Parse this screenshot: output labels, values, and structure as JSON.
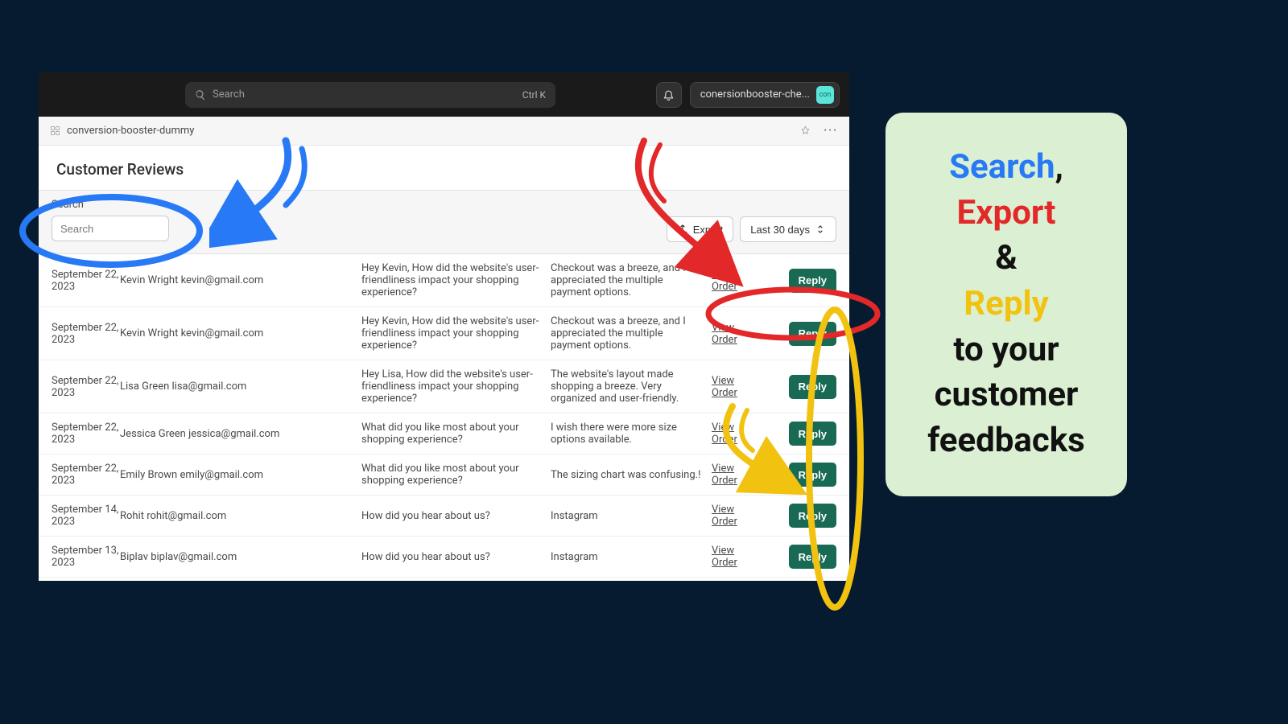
{
  "topbar": {
    "search_placeholder": "Search",
    "kbd": "Ctrl K",
    "store_name": "conersionbooster-che...",
    "avatar_text": "con"
  },
  "breadcrumb": {
    "label": "conversion-booster-dummy"
  },
  "page_title": "Customer Reviews",
  "filters": {
    "search_label": "Search",
    "search_placeholder": "Search",
    "export_label": "Export",
    "daterange_label": "Last 30 days"
  },
  "columns": {
    "view_order_text": "View Order",
    "reply_label": "Reply"
  },
  "reviews": [
    {
      "date": "September 22, 2023",
      "customer": "Kevin Wright kevin@gmail.com",
      "question": "Hey Kevin, How did the website's user-friendliness impact your shopping experience?",
      "answer": "Checkout was a breeze, and I appreciated the multiple payment options."
    },
    {
      "date": "September 22, 2023",
      "customer": "Kevin Wright kevin@gmail.com",
      "question": "Hey Kevin, How did the website's user-friendliness impact your shopping experience?",
      "answer": "Checkout was a breeze, and I appreciated the multiple payment options."
    },
    {
      "date": "September 22, 2023",
      "customer": "Lisa Green lisa@gmail.com",
      "question": "Hey Lisa, How did the website's user-friendliness impact your shopping experience?",
      "answer": "The website's layout made shopping a breeze. Very organized and user-friendly."
    },
    {
      "date": "September 22, 2023",
      "customer": "Jessica Green jessica@gmail.com",
      "question": "What did you like most about your shopping experience?",
      "answer": "I wish there were more size options available."
    },
    {
      "date": "September 22, 2023",
      "customer": "Emily Brown emily@gmail.com",
      "question": "What did you like most about your shopping experience?",
      "answer": "The sizing chart was confusing.!"
    },
    {
      "date": "September 14, 2023",
      "customer": "Rohit rohit@gmail.com",
      "question": "How did you hear about us?",
      "answer": "Instagram"
    },
    {
      "date": "September 13, 2023",
      "customer": "Biplav biplav@gmail.com",
      "question": "How did you hear about us?",
      "answer": "Instagram"
    }
  ],
  "promo": {
    "l1": "Search",
    "l1b": ",",
    "l2": "Export",
    "l3": "&",
    "l4": "Reply",
    "l5": "to your customer feedbacks"
  }
}
